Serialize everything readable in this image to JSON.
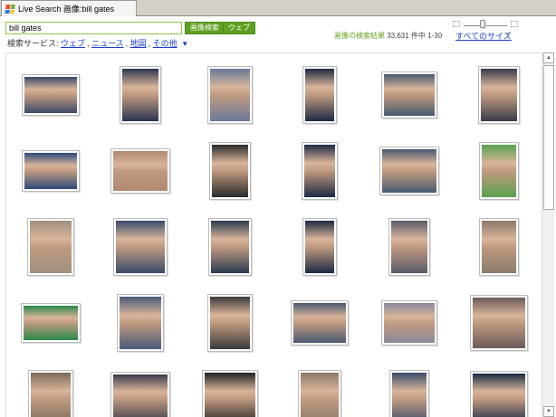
{
  "tab": {
    "title": "Live Search 画像:bill gates"
  },
  "search": {
    "value": "bill gates",
    "image_search_button": "画像検索",
    "web_button": "ウェブ"
  },
  "services": {
    "label": "検索サービス:",
    "links": [
      "ウェブ",
      "ニュース",
      "地図",
      "その他"
    ],
    "more_arrow": "▼"
  },
  "results": {
    "label": "画像の検索結果",
    "count": "33,631 件中 1-30"
  },
  "size_filter": {
    "label": "すべてのサイズ",
    "dropdown": "▼"
  },
  "colors": {
    "accent_green": "#5fa020",
    "link": "#1a3fcc"
  },
  "thumbnails": [
    {
      "color": "#3a4a6a"
    },
    {
      "color": "#2a3550"
    },
    {
      "color": "#6a7a9a"
    },
    {
      "color": "#1e2a44"
    },
    {
      "color": "#4a5a70"
    },
    {
      "color": "#3a3a4a"
    },
    {
      "color": "#2c4a7a"
    },
    {
      "color": "#b08a70"
    },
    {
      "color": "#2a2a2a"
    },
    {
      "color": "#1e2a44"
    },
    {
      "color": "#4a5a70"
    },
    {
      "color": "#5aa050"
    },
    {
      "color": "#a09080"
    },
    {
      "color": "#3a4a6a"
    },
    {
      "color": "#2a3a50"
    },
    {
      "color": "#1e2a44"
    },
    {
      "color": "#5a5a6a"
    },
    {
      "color": "#8a7a6a"
    },
    {
      "color": "#2a8a4a"
    },
    {
      "color": "#4a5a7a"
    },
    {
      "color": "#3a3a3a"
    },
    {
      "color": "#4a5a70"
    },
    {
      "color": "#8a8a9a"
    },
    {
      "color": "#6a5a5a"
    },
    {
      "color": "#7a6a5a"
    },
    {
      "color": "#3a3a4a"
    },
    {
      "color": "#222222"
    },
    {
      "color": "#8a7a6a"
    },
    {
      "color": "#3a4a6a"
    },
    {
      "color": "#1a2a44"
    }
  ]
}
